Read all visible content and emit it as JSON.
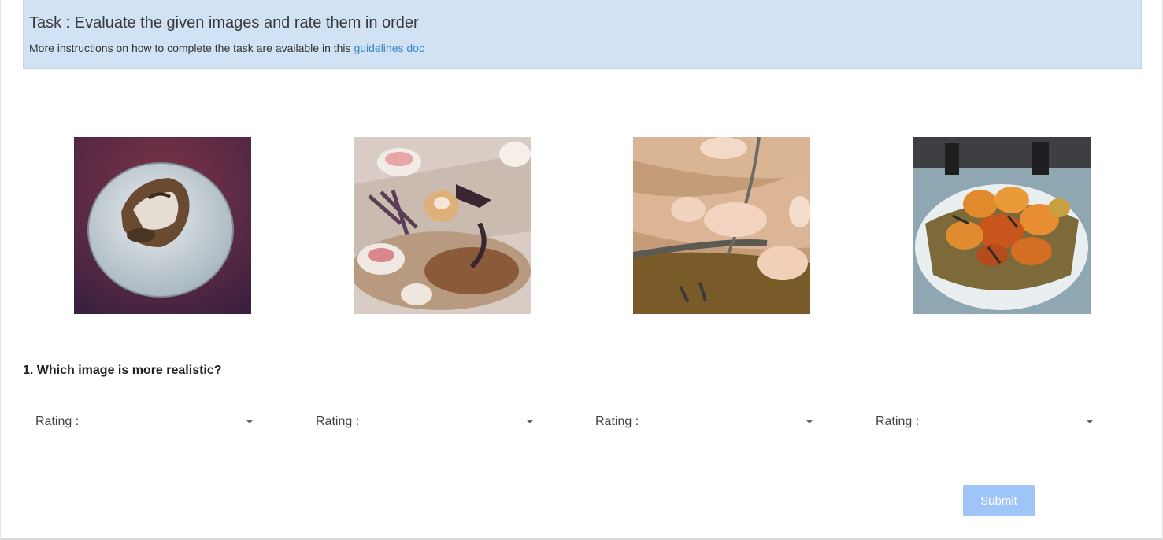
{
  "task": {
    "title": "Task : Evaluate the given images and rate them in order",
    "instructions_prefix": "More instructions on how to complete the task are available in this",
    "guidelines_link": "guidelines doc"
  },
  "images": [
    {
      "icon": "food-image-1"
    },
    {
      "icon": "food-image-2"
    },
    {
      "icon": "food-image-3"
    },
    {
      "icon": "food-image-4"
    }
  ],
  "question": {
    "text": "1. Which image is more realistic?"
  },
  "ratings": [
    {
      "label": "Rating :",
      "value": ""
    },
    {
      "label": "Rating :",
      "value": ""
    },
    {
      "label": "Rating :",
      "value": ""
    },
    {
      "label": "Rating :",
      "value": ""
    }
  ],
  "submit": {
    "label": "Submit"
  },
  "colors": {
    "banner_bg": "#d0e2f3",
    "link": "#3b86c4",
    "submit_bg": "#9fc5f8"
  }
}
